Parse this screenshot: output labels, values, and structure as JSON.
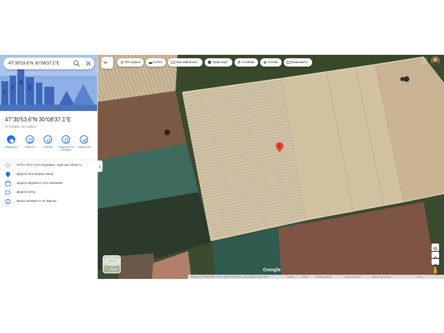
{
  "search": {
    "value": "47°30'53.6\"N 30°08'37.1\"E"
  },
  "place": {
    "title": "47°30'53.6\"N 30°08'37.1\"E",
    "decimal": "47.514881, 30.143644"
  },
  "actions": [
    {
      "label": "Маршрути",
      "icon": "directions-icon"
    },
    {
      "label": "Зберегти",
      "icon": "bookmark-icon"
    },
    {
      "label": "Поблизу",
      "icon": "nearby-icon"
    },
    {
      "label": "Надіслати на телефон",
      "icon": "send-to-phone-icon"
    },
    {
      "label": "Поділитися",
      "icon": "share-icon"
    }
  ],
  "info_rows": [
    {
      "label": "G47V+XF2 Село Журавка, Одеська область",
      "icon": "plus-code-icon"
    },
    {
      "label": "Додати пропущене місце",
      "icon": "add-place-icon"
    },
    {
      "label": "Додати відомості про компанію",
      "icon": "business-icon"
    },
    {
      "label": "Додати мітку",
      "icon": "label-icon"
    },
    {
      "label": "Ваша активність на Картах",
      "icon": "history-icon"
    }
  ],
  "map": {
    "layer_button": "Ye",
    "chips": [
      {
        "label": "Ресторани",
        "icon": "restaurant-icon"
      },
      {
        "label": "Готелі",
        "icon": "hotel-icon"
      },
      {
        "label": "Чим зайнятися",
        "icon": "activities-icon"
      },
      {
        "label": "Транспорт",
        "icon": "transit-icon"
      },
      {
        "label": "Стоянки",
        "icon": "parking-icon"
      },
      {
        "label": "Аптеки",
        "icon": "pharmacy-icon"
      },
      {
        "label": "Банкомати",
        "icon": "atm-icon"
      }
    ],
    "layers_label": "Шари",
    "logo": "Google",
    "footer": [
      "Зображення ©2023 CNES / Airbus, Maxar Technologies, Картографічні дані ©2023",
      "Україна",
      "Умови",
      "Конфіденційність",
      "Надіслати відгук",
      "Відгуки про продукт",
      "100 м"
    ]
  },
  "colors": {
    "accent": "#1a73e8",
    "pin": "#ea4335"
  }
}
